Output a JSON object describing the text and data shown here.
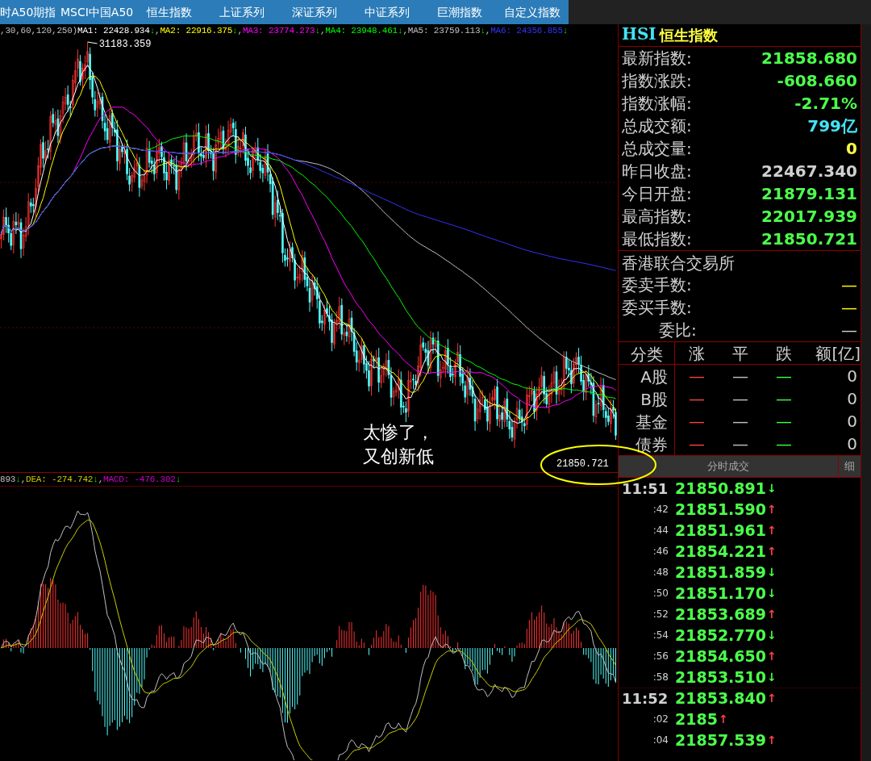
{
  "tabs": [
    {
      "label": "时A50期指"
    },
    {
      "label": "MSCI中国A50"
    },
    {
      "label": "恒生指数"
    },
    {
      "label": "上证系列"
    },
    {
      "label": "深证系列"
    },
    {
      "label": "中证系列"
    },
    {
      "label": "巨潮指数"
    },
    {
      "label": "自定义指数"
    }
  ],
  "price_chart": {
    "params": ",30,60,120,250)",
    "ma": [
      {
        "text": "MA1: 22428.934",
        "arrow": "↓",
        "sep": ",",
        "color": "#ffffff"
      },
      {
        "text": "MA2: 22916.375",
        "arrow": "↓",
        "sep": ",",
        "color": "#ffff00"
      },
      {
        "text": "MA3: 23774.273",
        "arrow": "↓",
        "sep": ",",
        "color": "#ff00ff"
      },
      {
        "text": "MA4: 23948.461",
        "arrow": "↓",
        "sep": ",",
        "color": "#00ff00"
      },
      {
        "text": "MA5: 23759.113",
        "arrow": "↓",
        "sep": ",",
        "color": "#c0c0c0"
      },
      {
        "text": "MA6: 24356.855",
        "arrow": "↓",
        "color": "#3333ff"
      }
    ],
    "high_label": "31183.359",
    "low_label": "21850.721",
    "annotation": [
      "太惨了，",
      "又创新低"
    ]
  },
  "macd_chart": {
    "items": [
      {
        "text": "893",
        "arrow": "↓",
        "sep": ",",
        "color": "#c0c0c0"
      },
      {
        "text": "DEA: -274.742",
        "arrow": "↓",
        "sep": ",",
        "color": "#cccc00"
      },
      {
        "text": "MACD: -476.302",
        "arrow": "↓",
        "color": "#cc00cc"
      }
    ]
  },
  "quote": {
    "code": "HSI",
    "name": "恒生指数",
    "stats": [
      {
        "label": "最新指数:",
        "value": "21858.680",
        "color": "#4cff4c"
      },
      {
        "label": "指数涨跌:",
        "value": "-608.660",
        "color": "#4cff4c"
      },
      {
        "label": "指数涨幅:",
        "value": "-2.71%",
        "color": "#4cff4c"
      },
      {
        "label": "总成交额:",
        "value": "799亿",
        "color": "#44e4f4"
      },
      {
        "label": "总成交量:",
        "value": "0",
        "color": "#ffff40"
      },
      {
        "label": "昨日收盘:",
        "value": "22467.340",
        "color": "#d0d0d0"
      },
      {
        "label": "今日开盘:",
        "value": "21879.131",
        "color": "#4cff4c"
      },
      {
        "label": "最高指数:",
        "value": "22017.939",
        "color": "#4cff4c"
      },
      {
        "label": "最低指数:",
        "value": "21850.721",
        "color": "#4cff4c"
      }
    ]
  },
  "exchange": {
    "name": "香港联合交易所",
    "rows": [
      {
        "label": "委卖手数:",
        "value": "—",
        "color": "#ffff00"
      },
      {
        "label": "委买手数:",
        "value": "—",
        "color": "#ffff00"
      },
      {
        "label": "委比:",
        "value": "—",
        "color": "#d0d0d0"
      }
    ]
  },
  "breakdown": {
    "columns": [
      "分类",
      "涨",
      "平",
      "跌",
      "额[亿]"
    ],
    "rows": [
      {
        "category": "A股",
        "up": "—",
        "flat": "—",
        "down": "—",
        "amount": "0"
      },
      {
        "category": "B股",
        "up": "—",
        "flat": "—",
        "down": "—",
        "amount": "0"
      },
      {
        "category": "基金",
        "up": "—",
        "flat": "—",
        "down": "—",
        "amount": "0"
      },
      {
        "category": "债券",
        "up": "—",
        "flat": "—",
        "down": "—",
        "amount": "0"
      }
    ]
  },
  "ticks": {
    "title": "分时成交",
    "detail_button": "细",
    "rows": [
      {
        "kind": "minute",
        "time": "11:51",
        "price": "21850.891",
        "arrow": "↓",
        "rising": false
      },
      {
        "kind": "second",
        "time": ":42",
        "price": "21851.590",
        "arrow": "↑",
        "rising": true
      },
      {
        "kind": "second",
        "time": ":44",
        "price": "21851.961",
        "arrow": "↑",
        "rising": true
      },
      {
        "kind": "second",
        "time": ":46",
        "price": "21854.221",
        "arrow": "↑",
        "rising": true
      },
      {
        "kind": "second",
        "time": ":48",
        "price": "21851.859",
        "arrow": "↓",
        "rising": false
      },
      {
        "kind": "second",
        "time": ":50",
        "price": "21851.170",
        "arrow": "↓",
        "rising": false
      },
      {
        "kind": "second",
        "time": ":52",
        "price": "21853.689",
        "arrow": "↑",
        "rising": true
      },
      {
        "kind": "second",
        "time": ":54",
        "price": "21852.770",
        "arrow": "↓",
        "rising": false
      },
      {
        "kind": "second",
        "time": ":56",
        "price": "21854.650",
        "arrow": "↑",
        "rising": true
      },
      {
        "kind": "second",
        "time": ":58",
        "price": "21853.510",
        "arrow": "↓",
        "rising": false
      },
      {
        "kind": "minute",
        "time": "11:52",
        "price": "21853.840",
        "arrow": "↑",
        "rising": true
      },
      {
        "kind": "second",
        "time": ":02",
        "price": "2185",
        "arrow": "↑",
        "rising": true
      },
      {
        "kind": "second",
        "time": ":04",
        "price": "21857.539",
        "arrow": "↑",
        "rising": true
      }
    ]
  }
}
